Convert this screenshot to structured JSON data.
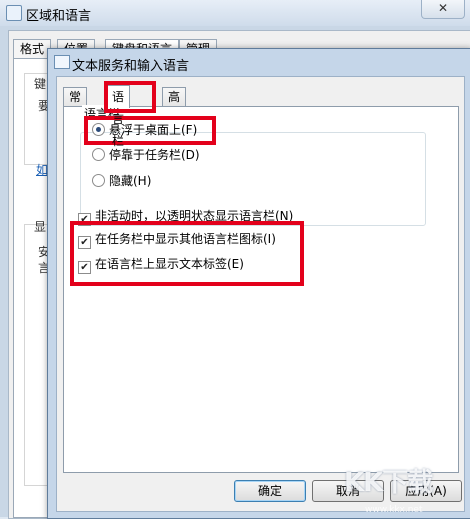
{
  "outer_window": {
    "title": "区域和语言",
    "close_glyph": "✕",
    "tabs": [
      "格式",
      "位置",
      "键盘和语言",
      "管理"
    ],
    "ghost_texts": [
      "键",
      "要",
      "如",
      "显",
      "安",
      "言"
    ]
  },
  "dialog": {
    "title": "文本服务和输入语言",
    "tabs": [
      "常规",
      "语言栏",
      "高级键设置"
    ],
    "active_tab": "语言栏",
    "group_label": "语言栏",
    "radios": [
      {
        "label": "悬浮于桌面上(F)",
        "checked": true
      },
      {
        "label": "停靠于任务栏(D)",
        "checked": false
      },
      {
        "label": "隐藏(H)",
        "checked": false
      }
    ],
    "checkboxes": [
      {
        "label": "非活动时，以透明状态显示语言栏(N)",
        "checked": true
      },
      {
        "label": "在任务栏中显示其他语言栏图标(I)",
        "checked": true
      },
      {
        "label": "在语言栏上显示文本标签(E)",
        "checked": true
      }
    ],
    "check_glyph": "✔",
    "buttons": {
      "ok": "确定",
      "cancel": "取消",
      "apply": "应用(A)"
    }
  },
  "highlight_color": "#e3001b",
  "watermark": {
    "text": "KK下载",
    "subtext": "www.kkx.net"
  }
}
